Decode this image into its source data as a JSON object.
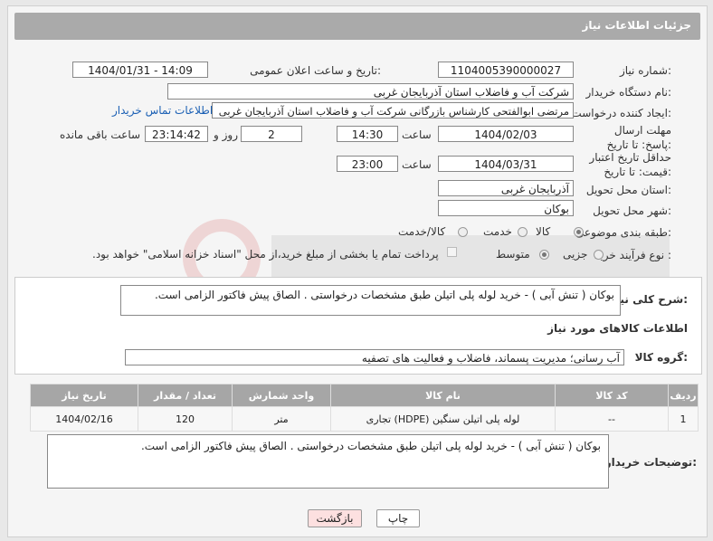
{
  "header": {
    "title": "جزئیات اطلاعات نیاز"
  },
  "form": {
    "need_number_label": "شماره نیاز:",
    "need_number": "1104005390000027",
    "announce_label": "تاریخ و ساعت اعلان عمومی:",
    "announce_value": "1404/01/31 - 14:09",
    "buyer_org_label": "نام دستگاه خریدار:",
    "buyer_org": "شرکت آب و فاضلاب استان آذربایجان غربی",
    "creator_label": "ایجاد کننده درخواست:",
    "creator": "مرتضی ابوالفتحی کارشناس بازرگانی شرکت آب و فاضلاب استان آذربایجان غربی",
    "contact_link": "اطلاعات تماس خریدار",
    "deadline_label": "مهلت ارسال پاسخ: تا تاریخ:",
    "deadline_date": "1404/02/03",
    "time_label": "ساعت",
    "deadline_time": "14:30",
    "days_value": "2",
    "days_label": "روز و",
    "remaining_time": "23:14:42",
    "remaining_label": "ساعت باقی مانده",
    "min_price_label": "حداقل تاریخ اعتبار قیمت: تا تاریخ:",
    "min_price_date": "1404/03/31",
    "min_price_time": "23:00",
    "province_label": "استان محل تحویل:",
    "province": "آذربایجان غربی",
    "city_label": "شهر محل تحویل:",
    "city": "بوکان",
    "category_label": "طبقه بندی موضوعی:",
    "category_options": [
      "کالا",
      "خدمت",
      "کالا/خدمت"
    ],
    "process_label": "نوع فرآیند خرید :",
    "process_options": [
      "جزیی",
      "متوسط"
    ],
    "payment_text": "پرداخت تمام یا بخشی از مبلغ خرید،از محل \"اسناد خزانه اسلامی\" خواهد بود."
  },
  "description": {
    "label": "شرح کلی نیاز:",
    "text": "بوکان ( تنش آبی ) - خرید لوله پلی اتیلن طبق مشخصات درخواستی . الصاق پیش فاکتور الزامی است."
  },
  "goods": {
    "section_title": "اطلاعات کالاهای مورد نیاز",
    "group_label": "گروه کالا:",
    "group_value": "آب رسانی؛ مدیریت پسماند، فاضلاب و فعالیت های تصفیه",
    "columns": [
      "ردیف",
      "کد کالا",
      "نام کالا",
      "واحد شمارش",
      "تعداد / مقدار",
      "تاریخ نیاز"
    ],
    "rows": [
      [
        "1",
        "--",
        "لوله پلی اتیلن سنگین (HDPE) تجاری",
        "متر",
        "120",
        "1404/02/16"
      ]
    ]
  },
  "buyer_notes": {
    "label": "توضیحات خریدار:",
    "text": "بوکان ( تنش آبی ) - خرید لوله پلی اتیلن طبق مشخصات درخواستی . الصاق پیش فاکتور الزامی است."
  },
  "buttons": {
    "print": "چاپ",
    "back": "بازگشت"
  },
  "colors": {
    "header_bg": "#aaaaaa",
    "link": "#1a5fb4",
    "back_button_bg": "#fde0e0"
  }
}
